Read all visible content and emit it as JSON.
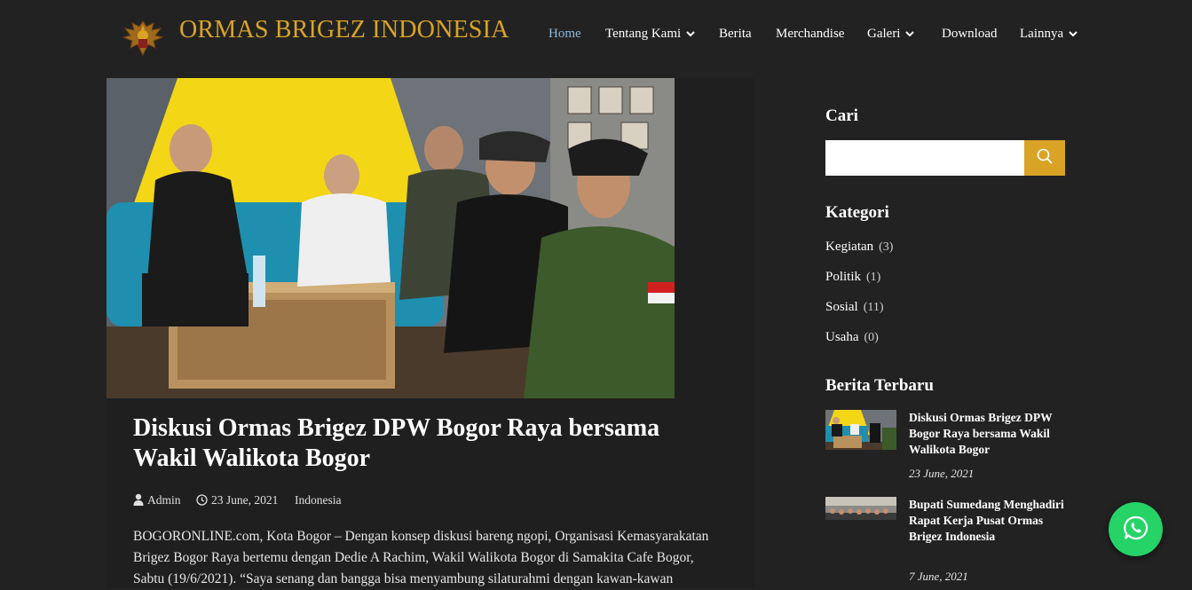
{
  "site": {
    "title": "ORMAS BRIGEZ INDONESIA"
  },
  "nav": {
    "home": "Home",
    "tentang": "Tentang Kami",
    "berita": "Berita",
    "merch": "Merchandise",
    "galeri": "Galeri",
    "download": "Download",
    "lainnya": "Lainnya"
  },
  "post": {
    "title": "Diskusi Ormas Brigez DPW Bogor Raya bersama Wakil Walikota Bogor",
    "author": "Admin",
    "date": "23 June, 2021",
    "category": "Indonesia",
    "excerpt_line1": "BOGORONLINE.com, Kota Bogor – Dengan konsep diskusi bareng ngopi, Organisasi Kemasyarakatan",
    "excerpt_line2": "Brigez Bogor Raya bertemu dengan Dedie A Rachim, Wakil Walikota Bogor di Samakita Cafe Bogor,",
    "excerpt_line3": "Sabtu (19/6/2021). “Saya senang dan bangga bisa menyambung silaturahmi dengan kawan-kawan"
  },
  "sidebar": {
    "search_title": "Cari",
    "search_value": "",
    "kategori_title": "Kategori",
    "categories": [
      {
        "name": "Kegiatan",
        "count": "(3)"
      },
      {
        "name": "Politik",
        "count": "(1)"
      },
      {
        "name": "Sosial",
        "count": "(11)"
      },
      {
        "name": "Usaha",
        "count": "(0)"
      }
    ],
    "recent_title": "Berita Terbaru",
    "recent": [
      {
        "title": "Diskusi Ormas Brigez DPW Bogor Raya bersama Wakil Walikota Bogor",
        "date": "23 June, 2021"
      },
      {
        "title": "Bupati Sumedang Menghadiri Rapat Kerja Pusat Ormas Brigez Indonesia",
        "date": "7 June, 2021"
      }
    ]
  },
  "colors": {
    "background": "#222222",
    "accent": "#d9a425",
    "nav_active": "#8fb8d8",
    "whatsapp": "#25d366"
  },
  "icons": {
    "search": "search-icon",
    "whatsapp": "whatsapp-icon",
    "author": "user-icon",
    "date": "clock-icon"
  }
}
